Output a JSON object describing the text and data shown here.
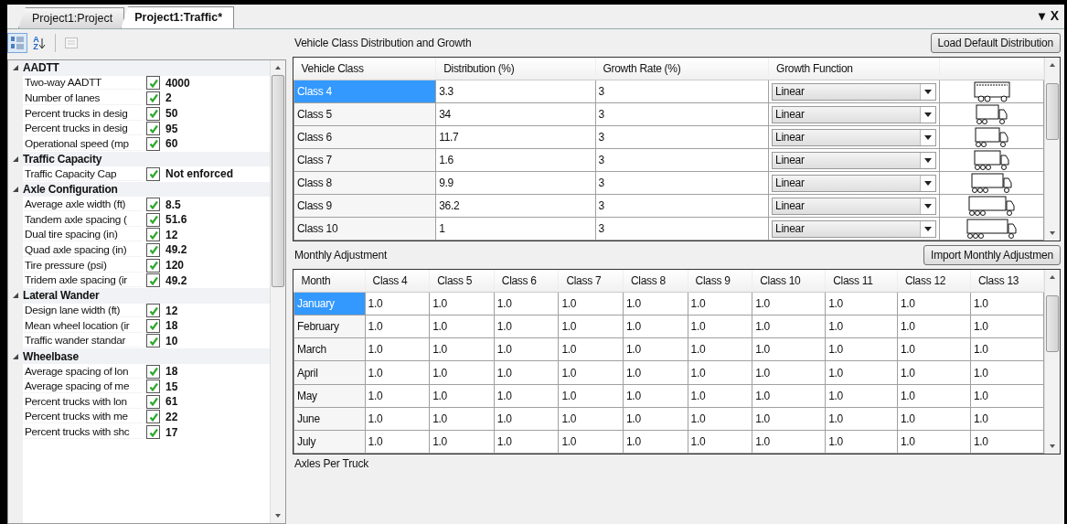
{
  "tabs": [
    {
      "label": "Project1:Project",
      "selected": false
    },
    {
      "label": "Project1:Traffic*",
      "selected": true
    }
  ],
  "window_controls": [
    "▾",
    "X"
  ],
  "toolbar": [
    {
      "kind": "categorized",
      "selected": true
    },
    {
      "kind": "alphabetical",
      "selected": false,
      "letters": [
        "A",
        "Z"
      ]
    },
    {
      "kind": "property_pages",
      "disabled": true
    }
  ],
  "properties": [
    {
      "category": "AADTT",
      "expanded": true,
      "items": [
        {
          "name": "Two-way AADTT",
          "checked": true,
          "value": "4000"
        },
        {
          "name": "Number of lanes",
          "checked": true,
          "value": "2"
        },
        {
          "name": "Percent trucks in desig",
          "checked": true,
          "value": "50"
        },
        {
          "name": "Percent trucks in desig",
          "checked": true,
          "value": "95"
        },
        {
          "name": "Operational speed (mp",
          "checked": true,
          "value": "60"
        }
      ]
    },
    {
      "category": "Traffic Capacity",
      "expanded": true,
      "items": [
        {
          "name": "Traffic Capacity Cap",
          "checked": true,
          "value": "Not enforced"
        }
      ]
    },
    {
      "category": "Axle Configuration",
      "expanded": true,
      "items": [
        {
          "name": "Average axle width (ft)",
          "checked": true,
          "value": "8.5"
        },
        {
          "name": "Tandem axle spacing (",
          "checked": true,
          "value": "51.6"
        },
        {
          "name": "Dual tire spacing (in)",
          "checked": true,
          "value": "12"
        },
        {
          "name": "Quad axle spacing (in)",
          "checked": true,
          "value": "49.2"
        },
        {
          "name": "Tire pressure (psi)",
          "checked": true,
          "value": "120"
        },
        {
          "name": "Tridem axle spacing (ir",
          "checked": true,
          "value": "49.2"
        }
      ]
    },
    {
      "category": "Lateral Wander",
      "expanded": true,
      "items": [
        {
          "name": "Design lane width (ft)",
          "checked": true,
          "value": "12"
        },
        {
          "name": "Mean wheel location (ir",
          "checked": true,
          "value": "18"
        },
        {
          "name": "Traffic wander standar",
          "checked": true,
          "value": "10"
        }
      ]
    },
    {
      "category": "Wheelbase",
      "expanded": true,
      "items": [
        {
          "name": "Average spacing of lon",
          "checked": true,
          "value": "18"
        },
        {
          "name": "Average spacing of me",
          "checked": true,
          "value": "15"
        },
        {
          "name": "Percent trucks with lon",
          "checked": true,
          "value": "61"
        },
        {
          "name": "Percent trucks with me",
          "checked": true,
          "value": "22"
        },
        {
          "name": "Percent trucks with shc",
          "checked": true,
          "value": "17"
        }
      ]
    }
  ],
  "vehicle_class": {
    "title": "Vehicle Class Distribution and Growth",
    "button": "Load Default Distribution",
    "columns": [
      "Vehicle Class",
      "Distribution (%)",
      "Growth Rate (%)",
      "Growth Function"
    ],
    "rows": [
      {
        "class": "Class 4",
        "distribution": "3.3",
        "growth_rate": "3",
        "growth_function": "Linear",
        "selected": true
      },
      {
        "class": "Class 5",
        "distribution": "34",
        "growth_rate": "3",
        "growth_function": "Linear",
        "selected": false
      },
      {
        "class": "Class 6",
        "distribution": "11.7",
        "growth_rate": "3",
        "growth_function": "Linear",
        "selected": false
      },
      {
        "class": "Class 7",
        "distribution": "1.6",
        "growth_rate": "3",
        "growth_function": "Linear",
        "selected": false
      },
      {
        "class": "Class 8",
        "distribution": "9.9",
        "growth_rate": "3",
        "growth_function": "Linear",
        "selected": false
      },
      {
        "class": "Class 9",
        "distribution": "36.2",
        "growth_rate": "3",
        "growth_function": "Linear",
        "selected": false
      },
      {
        "class": "Class 10",
        "distribution": "1",
        "growth_rate": "3",
        "growth_function": "Linear",
        "selected": false
      }
    ]
  },
  "monthly": {
    "title": "Monthly Adjustment",
    "button": "Import Monthly Adjustmen",
    "columns": [
      "Month",
      "Class 4",
      "Class 5",
      "Class 6",
      "Class 7",
      "Class 8",
      "Class 9",
      "Class 10",
      "Class 11",
      "Class 12",
      "Class 13"
    ],
    "rows": [
      {
        "month": "January",
        "selected": true,
        "values": [
          "1.0",
          "1.0",
          "1.0",
          "1.0",
          "1.0",
          "1.0",
          "1.0",
          "1.0",
          "1.0",
          "1.0"
        ]
      },
      {
        "month": "February",
        "selected": false,
        "values": [
          "1.0",
          "1.0",
          "1.0",
          "1.0",
          "1.0",
          "1.0",
          "1.0",
          "1.0",
          "1.0",
          "1.0"
        ]
      },
      {
        "month": "March",
        "selected": false,
        "values": [
          "1.0",
          "1.0",
          "1.0",
          "1.0",
          "1.0",
          "1.0",
          "1.0",
          "1.0",
          "1.0",
          "1.0"
        ]
      },
      {
        "month": "April",
        "selected": false,
        "values": [
          "1.0",
          "1.0",
          "1.0",
          "1.0",
          "1.0",
          "1.0",
          "1.0",
          "1.0",
          "1.0",
          "1.0"
        ]
      },
      {
        "month": "May",
        "selected": false,
        "values": [
          "1.0",
          "1.0",
          "1.0",
          "1.0",
          "1.0",
          "1.0",
          "1.0",
          "1.0",
          "1.0",
          "1.0"
        ]
      },
      {
        "month": "June",
        "selected": false,
        "values": [
          "1.0",
          "1.0",
          "1.0",
          "1.0",
          "1.0",
          "1.0",
          "1.0",
          "1.0",
          "1.0",
          "1.0"
        ]
      },
      {
        "month": "July",
        "selected": false,
        "values": [
          "1.0",
          "1.0",
          "1.0",
          "1.0",
          "1.0",
          "1.0",
          "1.0",
          "1.0",
          "1.0",
          "1.0"
        ]
      }
    ]
  },
  "next_section": {
    "title": "Axles Per Truck"
  }
}
